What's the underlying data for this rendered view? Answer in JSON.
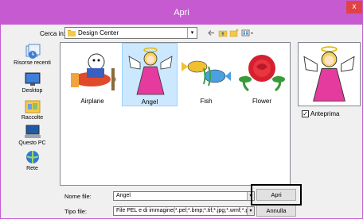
{
  "window": {
    "title": "Apri",
    "close_glyph": "x"
  },
  "lookin": {
    "label": "Cerca in:",
    "value": "Design Center",
    "arrow": "▾"
  },
  "places": [
    {
      "label": "Risorse recenti",
      "icon": "recent-places-icon"
    },
    {
      "label": "Desktop",
      "icon": "desktop-icon"
    },
    {
      "label": "Raccolte",
      "icon": "libraries-icon"
    },
    {
      "label": "Questo PC",
      "icon": "computer-icon"
    },
    {
      "label": "Rete",
      "icon": "network-icon"
    }
  ],
  "files": [
    {
      "name": "Airplane",
      "icon": "airplane-thumbnail"
    },
    {
      "name": "Angel",
      "icon": "angel-thumbnail",
      "selected": true
    },
    {
      "name": "Fish",
      "icon": "fish-thumbnail"
    },
    {
      "name": "Flower",
      "icon": "flower-thumbnail"
    }
  ],
  "preview": {
    "checkbox_label": "Anteprima",
    "checked": true,
    "check_glyph": "✓"
  },
  "filename": {
    "label": "Nome file:",
    "value": "Angel"
  },
  "filetype": {
    "label": "Tipo file:",
    "value": "File PEL e di immagine(*.pel;*.bmp;*.tif;*.jpg;*.wmf;*.pr"
  },
  "buttons": {
    "open": "Apri",
    "cancel": "Annulla"
  },
  "colors": {
    "titlebar": "#c65bd1",
    "selection": "#cce8ff",
    "close": "#e04343"
  }
}
